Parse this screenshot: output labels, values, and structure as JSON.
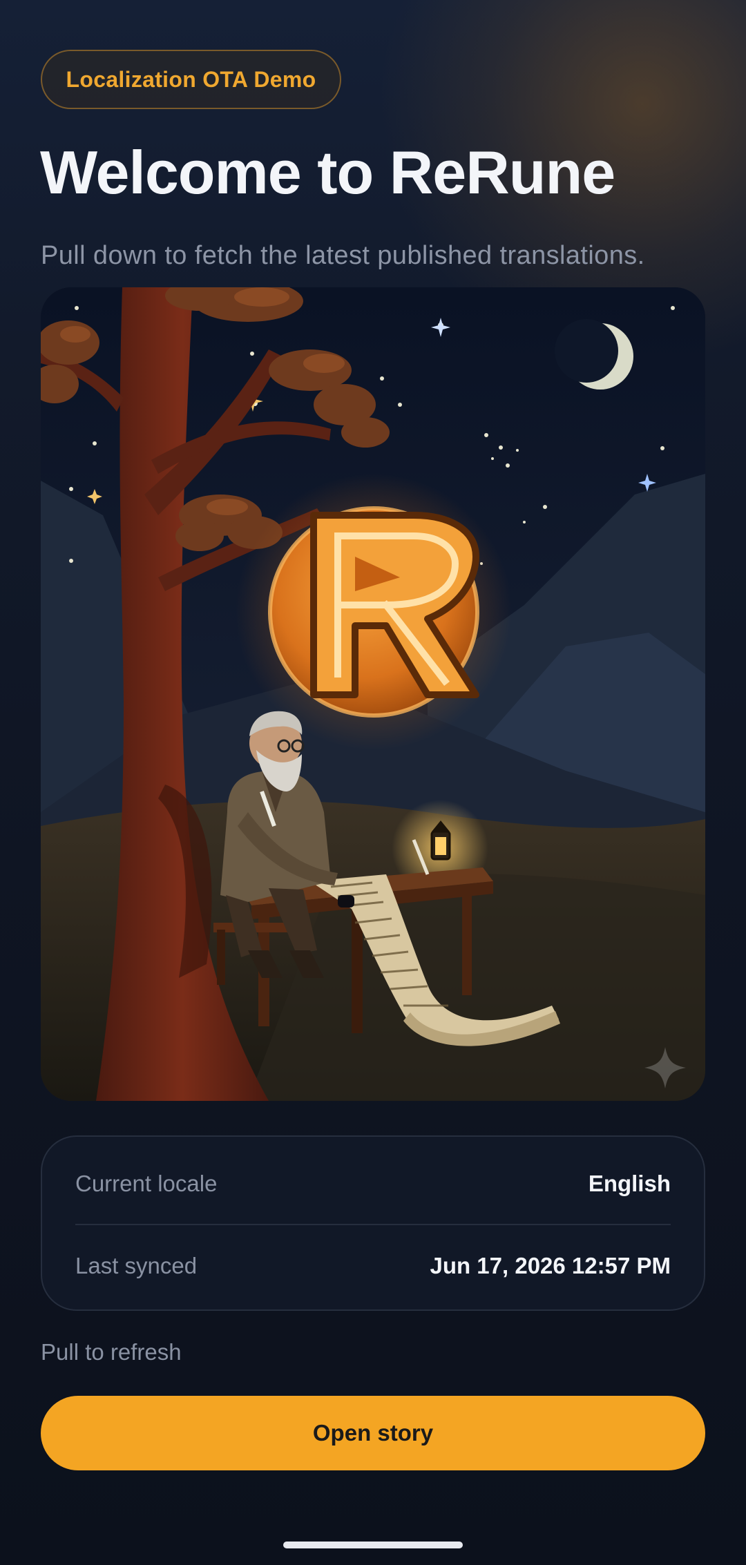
{
  "header": {
    "badge_label": "Localization OTA Demo",
    "title": "Welcome to ReRune",
    "subtitle": "Pull down to fetch the latest published translations."
  },
  "status_card": {
    "rows": [
      {
        "label": "Current locale",
        "value": "English"
      },
      {
        "label": "Last synced",
        "value": "Jun 17, 2026 12:57 PM"
      }
    ]
  },
  "refresh_hint": "Pull to refresh",
  "primary_action": {
    "label": "Open story"
  },
  "icons": {
    "hero_sparkle": "sparkle-icon",
    "rune_emblem": "rune-r-emblem"
  },
  "colors": {
    "background": "#0e131f",
    "accent": "#f4a523",
    "card": "#111827",
    "text_primary": "#f3f5f9",
    "text_secondary": "#8a92a3"
  }
}
